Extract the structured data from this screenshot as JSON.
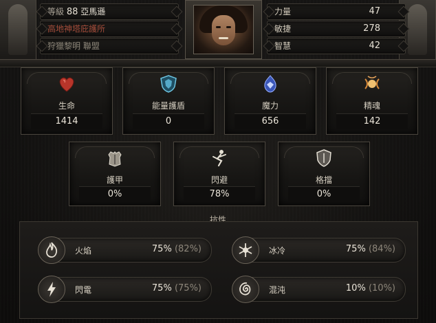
{
  "header": {
    "level_label": "等級",
    "level_value": "88",
    "class_name": "亞馬遜",
    "title_line": "高地神塔庇護所",
    "clan_line": "狩獵黎明 聯盟",
    "attributes": [
      {
        "name": "力量",
        "value": "47"
      },
      {
        "name": "敏捷",
        "value": "278"
      },
      {
        "name": "智慧",
        "value": "42"
      }
    ]
  },
  "core_stats": [
    {
      "icon": "heart-icon",
      "label": "生命",
      "value": "1414"
    },
    {
      "icon": "shield-icon",
      "label": "能量護盾",
      "value": "0"
    },
    {
      "icon": "mana-icon",
      "label": "魔力",
      "value": "656"
    },
    {
      "icon": "spirit-icon",
      "label": "精魂",
      "value": "142"
    }
  ],
  "defense_stats": [
    {
      "icon": "armour-icon",
      "label": "護甲",
      "value": "0%"
    },
    {
      "icon": "evasion-icon",
      "label": "閃避",
      "value": "78%"
    },
    {
      "icon": "block-icon",
      "label": "格擋",
      "value": "0%"
    }
  ],
  "resistances": {
    "title": "抗性",
    "items": [
      {
        "icon": "fire-icon",
        "name": "火焰",
        "value": "75%",
        "max": "(82%)"
      },
      {
        "icon": "cold-icon",
        "name": "冰冷",
        "value": "75%",
        "max": "(84%)"
      },
      {
        "icon": "lightning-icon",
        "name": "閃電",
        "value": "75%",
        "max": "(75%)"
      },
      {
        "icon": "chaos-icon",
        "name": "混沌",
        "value": "10%",
        "max": "(10%)"
      }
    ]
  },
  "colors": {
    "background": "#0b0a09",
    "text": "#cfc7b8",
    "title_red": "#a34c3a",
    "life_red": "#c0392b",
    "shield_cyan": "#55a9c8",
    "mana_blue": "#5f7fd6",
    "spirit_orange": "#e0a050"
  }
}
